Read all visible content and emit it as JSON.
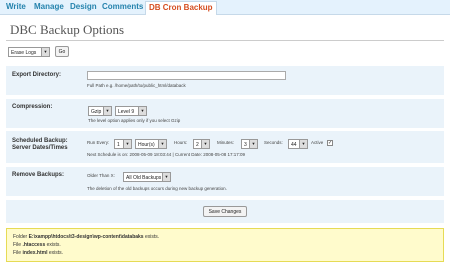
{
  "tabs": [
    {
      "label": "Write"
    },
    {
      "label": "Manage"
    },
    {
      "label": "Design"
    },
    {
      "label": "Comments"
    },
    {
      "label": "DB Cron Backup"
    }
  ],
  "page_title": "DBC Backup Options",
  "erase": {
    "select_value": "Erase Logs",
    "button_label": "Go"
  },
  "export": {
    "label": "Export Directory:",
    "value": "",
    "hint": "Full Path e.g. /home/path/to/public_html/databack"
  },
  "compression": {
    "label": "Compression:",
    "type_value": "Gzip",
    "level_value": "Level 9",
    "hint": "The level option applies only if you select Gzip"
  },
  "schedule": {
    "label_line1": "Scheduled Backup:",
    "label_line2": "Server Dates/Times",
    "run_every_label": "Run Every:",
    "run_every_value": "1",
    "unit_value": "Hour(s)",
    "hours_label": "Hours:",
    "hours_value": "2",
    "minutes_label": "Minutes:",
    "minutes_value": "3",
    "seconds_label": "Seconds:",
    "seconds_value": "44",
    "active_label": "Active",
    "active_checked": "✓",
    "next_schedule": "Next Schedule is on: 2008-05-09 18:03:44 | Current Date: 2008-05-08 17:17:09"
  },
  "remove": {
    "label": "Remove Backups:",
    "older_than_label": "Older Than X:",
    "value": "All Old Backups",
    "hint": "The deletion of the old backups occurs during new backup generation."
  },
  "save_label": "Save Changes",
  "notice": {
    "line1_prefix": "Folder",
    "line1_path": "E:\\xampp\\htdocs\\t3-design\\wp-content\\databaks",
    "line1_suffix": "exists.",
    "line2_prefix": "File",
    "line2_file": ".htaccess",
    "line2_suffix": "exists.",
    "line3_prefix": "File",
    "line3_file": "index.html",
    "line3_suffix": "exists."
  }
}
